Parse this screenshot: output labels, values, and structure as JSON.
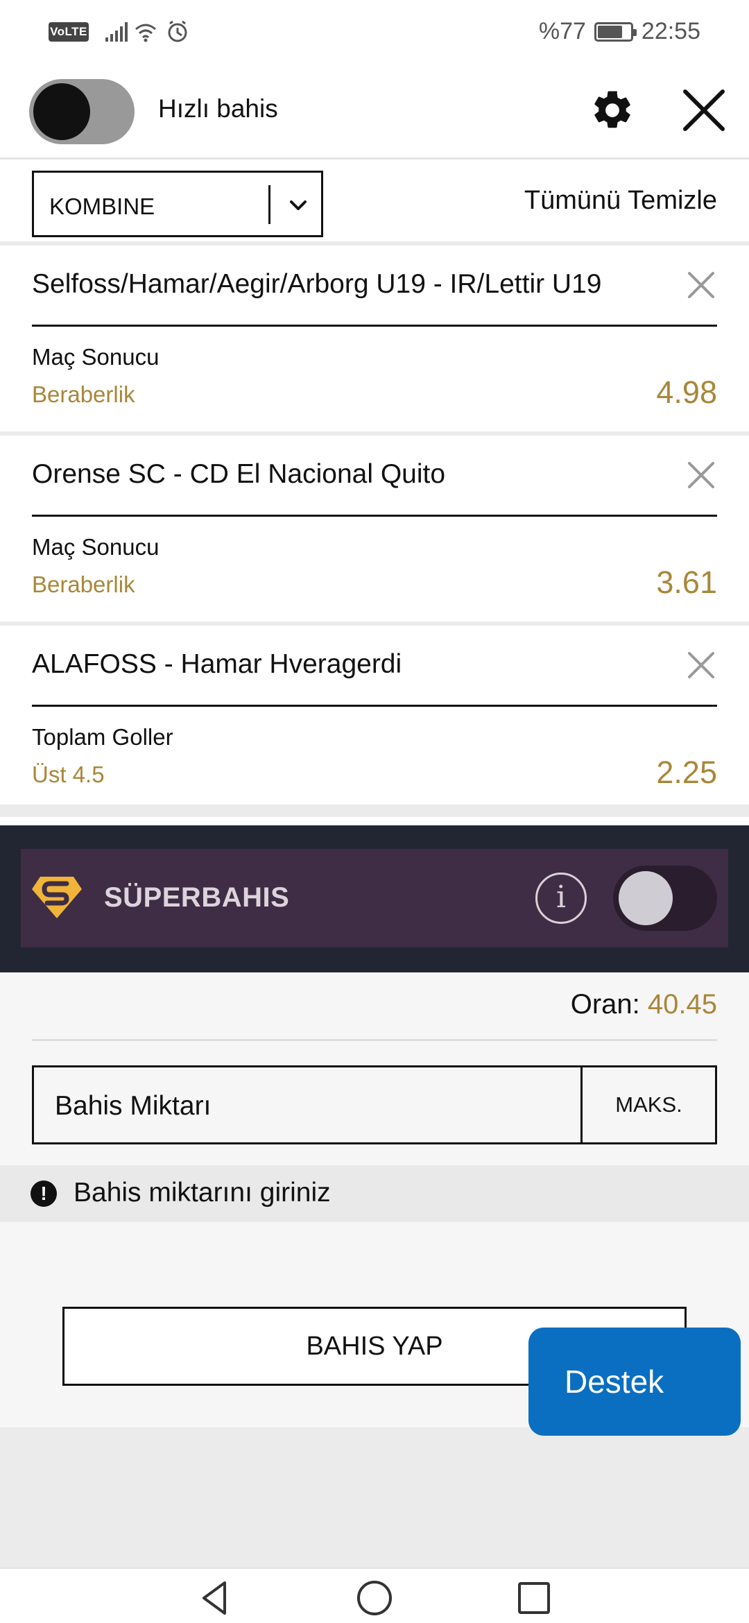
{
  "status_bar": {
    "volte": "VoLTE",
    "battery_text": "%77",
    "battery_level": 0.77,
    "time": "22:55"
  },
  "header": {
    "quick_bet_label": "Hızlı bahis",
    "quick_bet_on": false
  },
  "bet_type": {
    "selected": "KOMBINE",
    "clear_all": "Tümünü Temizle"
  },
  "bets": [
    {
      "match": "Selfoss/Hamar/Aegir/Arborg U19 - IR/Lettir U19",
      "market": "Maç Sonucu",
      "selection": "Beraberlik",
      "odds": "4.98"
    },
    {
      "match": "Orense SC - CD El Nacional Quito",
      "market": "Maç Sonucu",
      "selection": "Beraberlik",
      "odds": "3.61"
    },
    {
      "match": "ALAFOSS - Hamar Hveragerdi",
      "market": "Toplam Goller",
      "selection": "Üst 4.5",
      "odds": "2.25"
    }
  ],
  "super_bahis": {
    "title": "SÜPERBAHIS",
    "info_glyph": "i",
    "enabled": false
  },
  "stake": {
    "oran_label": "Oran: ",
    "oran_value": "40.45",
    "amount_placeholder": "Bahis Miktarı",
    "max_label": "MAKS.",
    "warning": "Bahis miktarını giriniz",
    "warning_glyph": "!",
    "place_bet": "BAHIS YAP"
  },
  "support": {
    "label": "Destek"
  },
  "colors": {
    "odds_gold": "#a8873a",
    "super_bg": "#3f2c45",
    "support_blue": "#0a6fc1"
  },
  "icons": {
    "settings": "gear-icon",
    "close": "close-icon",
    "remove": "close-icon",
    "dropdown": "chevron-down-icon",
    "info": "info-icon",
    "warning": "exclamation-icon",
    "back": "triangle-back-icon",
    "home": "circle-home-icon",
    "recents": "square-recents-icon"
  }
}
